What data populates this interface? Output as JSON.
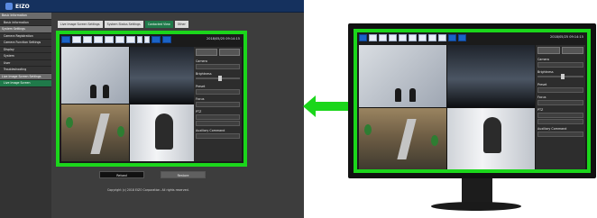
{
  "app": {
    "brand": "EIZO",
    "sidebar": [
      {
        "label": "Basic Information",
        "type": "section"
      },
      {
        "label": "Basic Information",
        "type": "item"
      },
      {
        "label": "System Settings",
        "type": "section"
      },
      {
        "label": "Camera Registration",
        "type": "item"
      },
      {
        "label": "Camera Function Settings",
        "type": "item"
      },
      {
        "label": "Display",
        "type": "item"
      },
      {
        "label": "System",
        "type": "item"
      },
      {
        "label": "User",
        "type": "item"
      },
      {
        "label": "Troubleshooting",
        "type": "item"
      },
      {
        "label": "Live Image Screen Settings",
        "type": "section"
      },
      {
        "label": "Live Image Screen",
        "type": "active"
      }
    ],
    "tabs": [
      {
        "label": "Live Image Screen Settings",
        "active": false
      },
      {
        "label": "System Status Settings",
        "active": false
      },
      {
        "label": "Contacted View",
        "active": true
      },
      {
        "label": "Other",
        "active": false
      }
    ],
    "datetime": "2018/05/25 09:14:15",
    "side_panel": {
      "labels": [
        "Camera",
        "Brightness",
        "Preset",
        "Focus",
        "PTZ",
        "Auxiliary Command"
      ]
    },
    "buttons": [
      {
        "label": "Reload",
        "dim": false
      },
      {
        "label": "Restore",
        "dim": true
      }
    ],
    "copyright": "Copyright (c) 2018 EIZO Corporation. All rights reserved."
  },
  "monitor": {
    "datetime": "2018/05/25 09:14:15",
    "side_panel": {
      "labels": [
        "Camera",
        "Brightness",
        "Preset",
        "Focus",
        "PTZ",
        "Auxiliary Command"
      ]
    }
  },
  "colors": {
    "highlight": "#1bd61b",
    "active_tab": "#1f7a4a",
    "toolbar_on": "#1b63c6"
  }
}
